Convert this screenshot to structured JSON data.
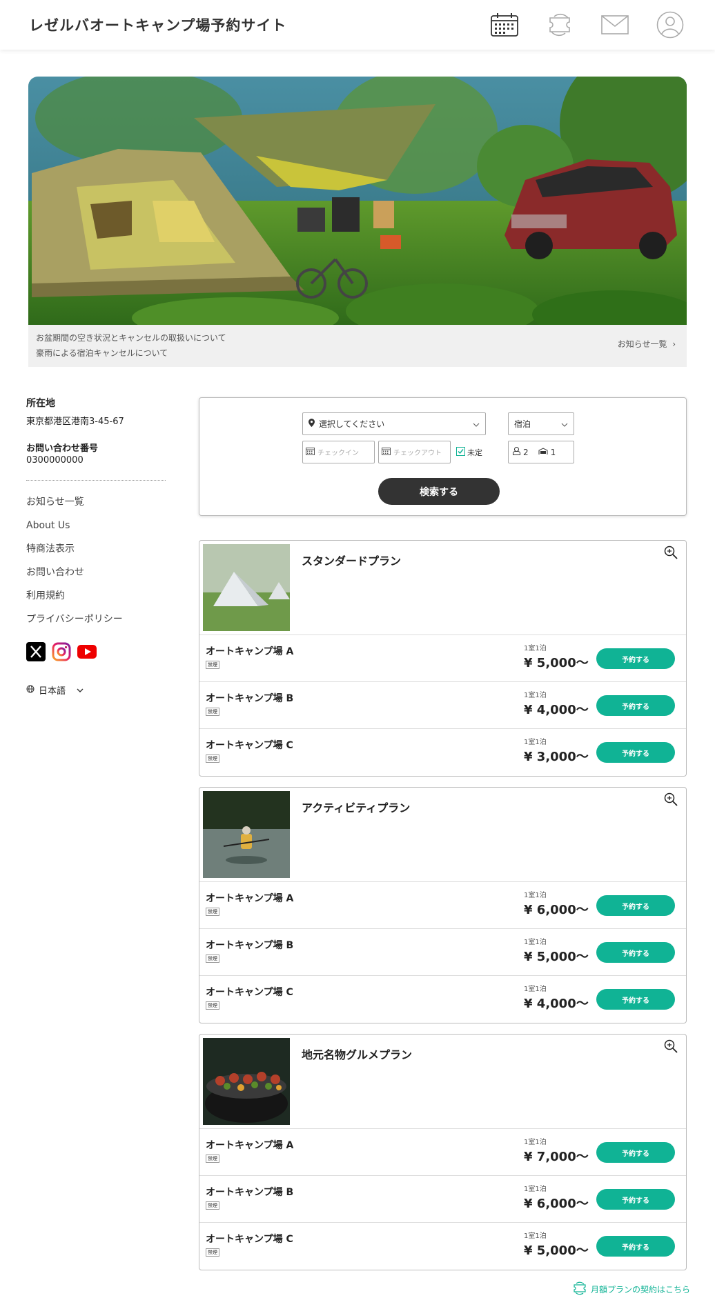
{
  "header": {
    "title": "レゼルバオートキャンプ場予約サイト",
    "icons": [
      "calendar-icon",
      "refresh-ticket-icon",
      "mail-icon",
      "user-icon"
    ]
  },
  "news": {
    "items": [
      "お盆期間の空き状況とキャンセルの取扱いについて",
      "豪雨による宿泊キャンセルについて"
    ],
    "all_label": "お知らせ一覧"
  },
  "sidebar": {
    "address_label": "所在地",
    "address": "東京都港区港南3-45-67",
    "phone_label": "お問い合わせ番号",
    "phone": "0300000000",
    "links": [
      "お知らせ一覧",
      "About Us",
      "特商法表示",
      "お問い合わせ",
      "利用規約",
      "プライバシーポリシー"
    ],
    "language": "日本語"
  },
  "search": {
    "location_placeholder": "選択してください",
    "stay_type": "宿泊",
    "checkin_placeholder": "チェックイン",
    "checkout_placeholder": "チェックアウト",
    "undecided_label": "未定",
    "adults": "2",
    "rooms": "1",
    "button_label": "検索する"
  },
  "plans": [
    {
      "name": "スタンダードプラン",
      "rows": [
        {
          "name": "オートキャンプ場 A",
          "badge": "禁煙",
          "per": "1室1泊",
          "price": "¥ 5,000〜",
          "button": "予約する"
        },
        {
          "name": "オートキャンプ場 B",
          "badge": "禁煙",
          "per": "1室1泊",
          "price": "¥ 4,000〜",
          "button": "予約する"
        },
        {
          "name": "オートキャンプ場 C",
          "badge": "禁煙",
          "per": "1室1泊",
          "price": "¥ 3,000〜",
          "button": "予約する"
        }
      ]
    },
    {
      "name": "アクティビティプラン",
      "rows": [
        {
          "name": "オートキャンプ場 A",
          "badge": "禁煙",
          "per": "1室1泊",
          "price": "¥ 6,000〜",
          "button": "予約する"
        },
        {
          "name": "オートキャンプ場 B",
          "badge": "禁煙",
          "per": "1室1泊",
          "price": "¥ 5,000〜",
          "button": "予約する"
        },
        {
          "name": "オートキャンプ場 C",
          "badge": "禁煙",
          "per": "1室1泊",
          "price": "¥ 4,000〜",
          "button": "予約する"
        }
      ]
    },
    {
      "name": "地元名物グルメプラン",
      "rows": [
        {
          "name": "オートキャンプ場 A",
          "badge": "禁煙",
          "per": "1室1泊",
          "price": "¥ 7,000〜",
          "button": "予約する"
        },
        {
          "name": "オートキャンプ場 B",
          "badge": "禁煙",
          "per": "1室1泊",
          "price": "¥ 6,000〜",
          "button": "予約する"
        },
        {
          "name": "オートキャンプ場 C",
          "badge": "禁煙",
          "per": "1室1泊",
          "price": "¥ 5,000〜",
          "button": "予約する"
        }
      ]
    }
  ],
  "monthly_link": "月額プランの契約はこちら",
  "colors": {
    "accent": "#10b395",
    "dark_button": "#333333"
  }
}
